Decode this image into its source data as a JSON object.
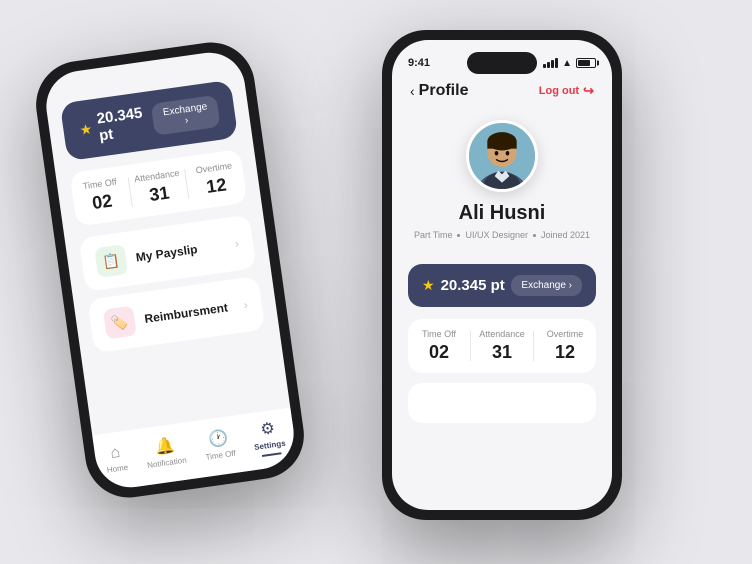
{
  "background": "#e8e8ec",
  "left_phone": {
    "points": {
      "value": "20.345 pt",
      "exchange_label": "Exchange ›"
    },
    "stats": [
      {
        "label": "Time Off",
        "value": "02"
      },
      {
        "label": "Attendance",
        "value": "31"
      },
      {
        "label": "Overtime",
        "value": "12"
      }
    ],
    "menu": [
      {
        "label": "My Payslip",
        "icon": "📋",
        "icon_class": "menu-icon-green"
      },
      {
        "label": "Reimbursment",
        "icon": "🏷️",
        "icon_class": "menu-icon-red"
      }
    ],
    "nav": [
      {
        "label": "Home",
        "icon": "⌂",
        "active": false
      },
      {
        "label": "Notification",
        "icon": "🔔",
        "active": false
      },
      {
        "label": "Time Off",
        "icon": "🕐",
        "active": false
      },
      {
        "label": "Settings",
        "icon": "⚙",
        "active": true
      }
    ]
  },
  "right_phone": {
    "status_time": "9:41",
    "header": {
      "back_label": "Profile",
      "logout_label": "Log out"
    },
    "profile": {
      "name": "Ali Husni",
      "type": "Part Time",
      "role": "UI/UX Designer",
      "joined": "Joined 2021"
    },
    "points": {
      "value": "20.345 pt",
      "exchange_label": "Exchange ›"
    },
    "stats": [
      {
        "label": "Time Off",
        "value": "02"
      },
      {
        "label": "Attendance",
        "value": "31"
      },
      {
        "label": "Overtime",
        "value": "12"
      }
    ]
  }
}
